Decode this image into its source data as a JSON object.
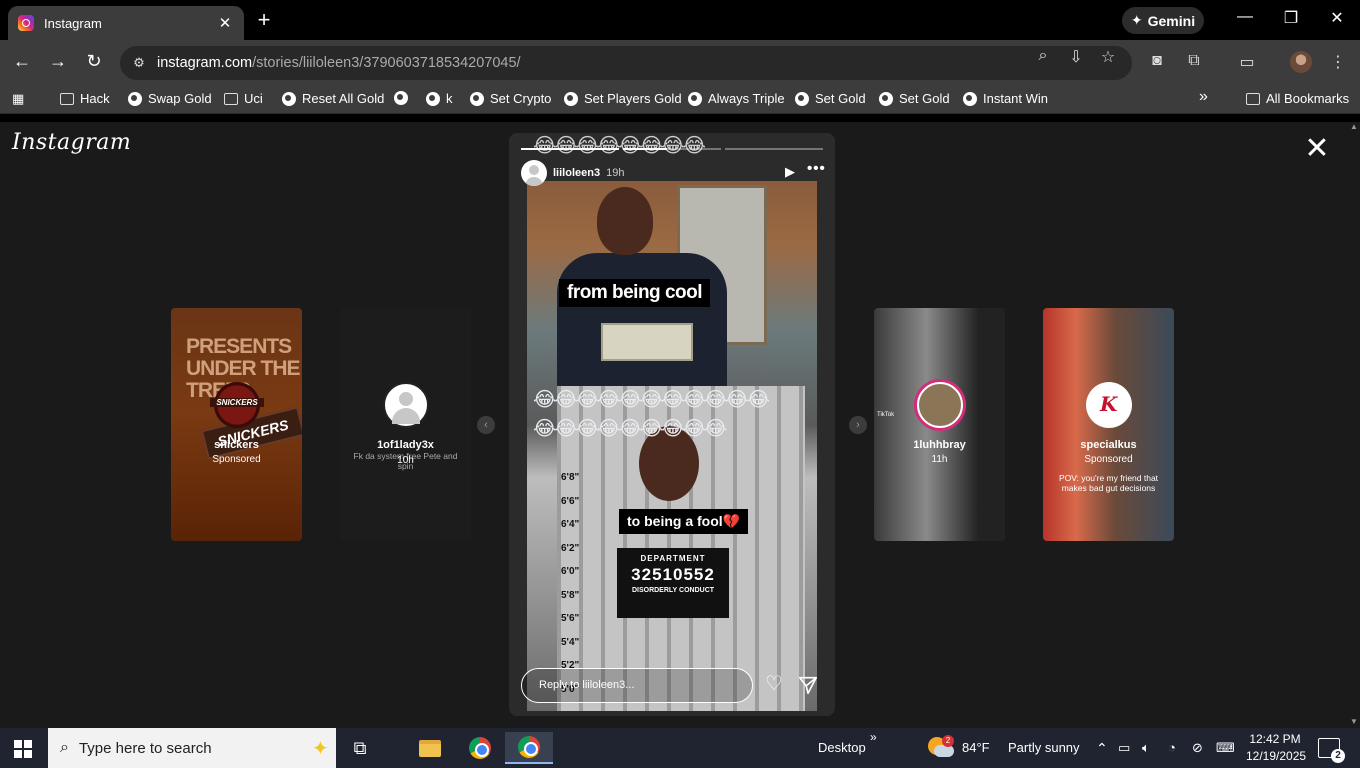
{
  "browser": {
    "tab_title": "Instagram",
    "tab_close": "✕",
    "new_tab": "+",
    "gemini_label": "Gemini",
    "url_domain": "instagram.com",
    "url_path": "/stories/liiloleen3/3790603718534207045/",
    "window_controls": {
      "minimize": "—",
      "restore": "❐",
      "close": "✕"
    }
  },
  "bookmarks": {
    "items": [
      {
        "label": "Hack",
        "icon": "folder-icon"
      },
      {
        "label": "Swap Gold",
        "icon": "globe-icon"
      },
      {
        "label": "Uci",
        "icon": "folder-icon"
      },
      {
        "label": "Reset All Gold",
        "icon": "globe-icon"
      },
      {
        "label": "",
        "icon": "globe-icon"
      },
      {
        "label": "k",
        "icon": "globe-icon"
      },
      {
        "label": "Set Crypto",
        "icon": "globe-icon"
      },
      {
        "label": "Set Players Gold",
        "icon": "globe-icon"
      },
      {
        "label": "Always Triple",
        "icon": "globe-icon"
      },
      {
        "label": "Set Gold",
        "icon": "globe-icon"
      },
      {
        "label": "Set Gold",
        "icon": "globe-icon"
      },
      {
        "label": "Instant Win",
        "icon": "globe-icon"
      }
    ],
    "overflow": "»",
    "all_bookmarks": "All Bookmarks"
  },
  "instagram": {
    "logo": "Instagram",
    "close": "✕",
    "side_stories": [
      {
        "name": "snickers",
        "sub": "Sponsored",
        "banner": "PRESENTS UNDER THE TREE?",
        "brand": "SNICKERS"
      },
      {
        "name": "1of1lady3x",
        "sub": "10h",
        "caption": "Fk da system free Pete and spin"
      },
      {
        "name": "1luhhbray",
        "sub": "11h",
        "watermark": "TikTok"
      },
      {
        "name": "specialkus",
        "sub": "Sponsored",
        "caption": "POV: you're my friend that makes bad gut decisions",
        "brand": "K"
      }
    ],
    "prev_arrow": "‹",
    "next_arrow": "›",
    "story": {
      "username": "liiloleen3",
      "time": "19h",
      "segments_total": 3,
      "segments_done": 1,
      "active_fraction": 0.45,
      "caption_top": "from being cool",
      "caption_bottom": "to being a fool💔",
      "emoji_row1": "😂😂😂😂😂😂😂😂😂😂😂",
      "emoji_row2": "😂😂😂😂😂😂😂😂😂",
      "emoji_top": "😂😂😂😂😂😂😂😂",
      "placard_dept": "DEPARTMENT",
      "placard_number": "32510552",
      "placard_charge": "DISORDERLY CONDUCT",
      "heights": [
        "6'8\"",
        "6'6\"",
        "6'4\"",
        "6'2\"",
        "6'0\"",
        "5'8\"",
        "5'6\"",
        "5'4\"",
        "5'2\"",
        "5'0\""
      ],
      "reply_placeholder": "Reply to liiloleen3..."
    }
  },
  "taskbar": {
    "search_placeholder": "Type here to search",
    "desktop_label": "Desktop",
    "desktop_chevron": "»",
    "weather_temp": "84°F",
    "weather_text": "Partly sunny",
    "weather_badge": "2",
    "time": "12:42 PM",
    "date": "12/19/2025",
    "notifications": "2"
  }
}
